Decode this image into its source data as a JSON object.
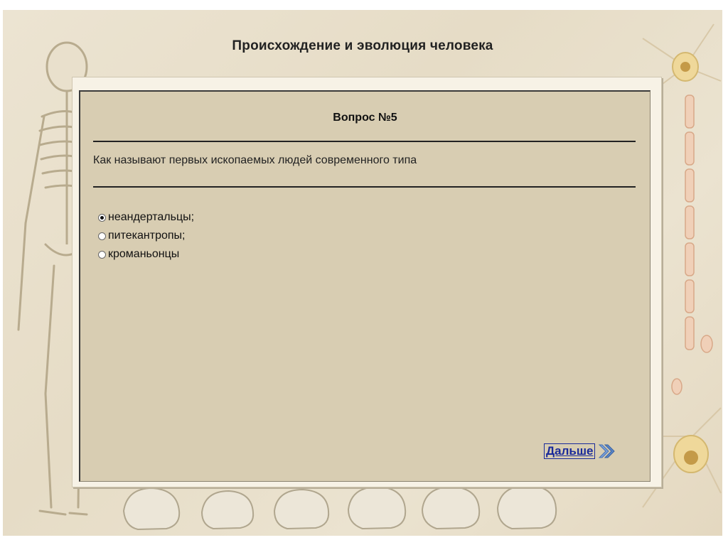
{
  "page": {
    "title": "Происхождение и эволюция человека"
  },
  "quiz": {
    "question_number": "Вопрос №5",
    "question_text": "Как называют первых ископаемых людей современного типа",
    "options": [
      {
        "label": "неандертальцы;",
        "selected": true
      },
      {
        "label": "питекантропы;",
        "selected": false
      },
      {
        "label": "кроманьонцы",
        "selected": false
      }
    ],
    "next_label": "Дальше"
  },
  "colors": {
    "panel_bg": "#d8cdb2",
    "link": "#1a2a9a",
    "arrow": "#5a86c8"
  },
  "icons": {
    "next": "double-chevron-right-icon"
  }
}
